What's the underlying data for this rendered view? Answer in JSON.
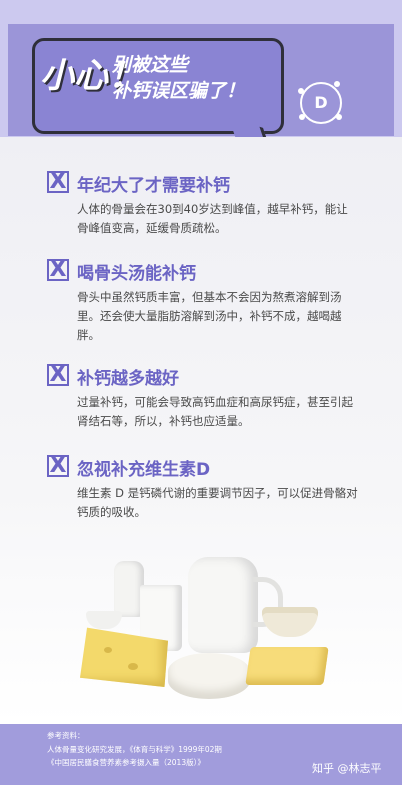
{
  "header": {
    "big_text": "小心！",
    "line1": "别被这些",
    "line2": "补钙误区骗了！",
    "icon_letter": "D"
  },
  "items": [
    {
      "mark": "X",
      "title": "年纪大了才需要补钙",
      "body": "人体的骨量会在30到40岁达到峰值，越早补钙，能让骨峰值变高，延缓骨质疏松。"
    },
    {
      "mark": "X",
      "title": "喝骨头汤能补钙",
      "body": "骨头中虽然钙质丰富，但基本不会因为熬煮溶解到汤里。还会使大量脂肪溶解到汤中，补钙不成，越喝越胖。"
    },
    {
      "mark": "X",
      "title": "补钙越多越好",
      "body": "过量补钙，可能会导致高钙血症和高尿钙症，甚至引起肾结石等，所以，补钙也应适量。"
    },
    {
      "mark": "X",
      "title": "忽视补充维生素D",
      "body": "维生素 D 是钙磷代谢的重要调节因子，可以促进骨骼对钙质的吸收。"
    }
  ],
  "footer": {
    "ref_title": "参考资料：",
    "ref_line1": "人体骨量变化研究发展，《体育与科学》1999年02期",
    "ref_line2": "《中国居民膳食营养素参考摄入量（2013版）》",
    "watermark": "知乎 @林志平"
  },
  "colors": {
    "header_bg": "#ccc9ef",
    "panel": "#9b95d8",
    "bubble": "#8a84d3",
    "accent": "#6b64c4",
    "footer": "#a19cdc"
  }
}
